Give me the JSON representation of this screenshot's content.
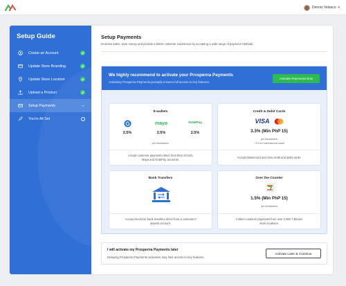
{
  "colors": {
    "primary": "#2f6fd6",
    "success": "#2dba4e",
    "check": "#3ecf6e"
  },
  "topbar": {
    "logo_icon": "prosperna-logo-icon",
    "user_name": "Dennis Velasco",
    "chevron_icon": "chevron-down-icon"
  },
  "sidebar": {
    "title": "Setup Guide",
    "items": [
      {
        "label": "Create an Account",
        "icon": "user-circle-icon",
        "status": "done"
      },
      {
        "label": "Update Store Branding",
        "icon": "store-card-icon",
        "status": "done"
      },
      {
        "label": "Update Store Location",
        "icon": "location-pin-icon",
        "status": "done"
      },
      {
        "label": "Upload a Product",
        "icon": "upload-icon",
        "status": "done"
      },
      {
        "label": "Setup Payments",
        "icon": "wallet-icon",
        "status": "current"
      },
      {
        "label": "You're All Set",
        "icon": "rocket-icon",
        "status": "pending"
      }
    ]
  },
  "main": {
    "title": "Setup Payments",
    "subtitle": "Increase sales, save money and provide a better customer experience by accepting a wide range of payment methods."
  },
  "recommend": {
    "title": "We highly recommend to activate your Prosperna Payments",
    "subtitle": "Activating Prosperna Payments promptly ensures full access to key features.",
    "button": "Activate Payments Now"
  },
  "cards": {
    "ewallets": {
      "title": "E-wallets",
      "providers": [
        {
          "name": "gcash",
          "rate": "2.5%"
        },
        {
          "name": "maya",
          "rate": "2.5%"
        },
        {
          "name": "GrabPay",
          "rate": "2.5%"
        }
      ],
      "note": "per transaction",
      "desc": "Accept customer payments direct from their GCash, Maya and GrabPay accounts."
    },
    "cards": {
      "title": "Credit & Debit Cards",
      "visa": "VISA",
      "rate": "3.3% (Min PhP 15)",
      "note1": "per transaction",
      "note2": "+1% for international cards",
      "desc": "Accept Mastercard and Visa credit and debit cards."
    },
    "bank": {
      "title": "Bank Transfers",
      "icon": "bank-transfer-icon",
      "desc": "Accept electronic bank transfers direct from a customer's deposit account."
    },
    "otc": {
      "title": "Over the Counter",
      "icon": "seven-eleven-icon",
      "rate": "1.5% (Min PhP 15)",
      "note": "per transaction",
      "desc": "Collect customer payments from over 2,900 7-Eleven store locations."
    }
  },
  "later": {
    "title": "I will activate my Prosperna Payments later",
    "subtitle": "Delaying Prosperna Payments activation may limit access to key features.",
    "button": "Activate Later & Continue"
  }
}
